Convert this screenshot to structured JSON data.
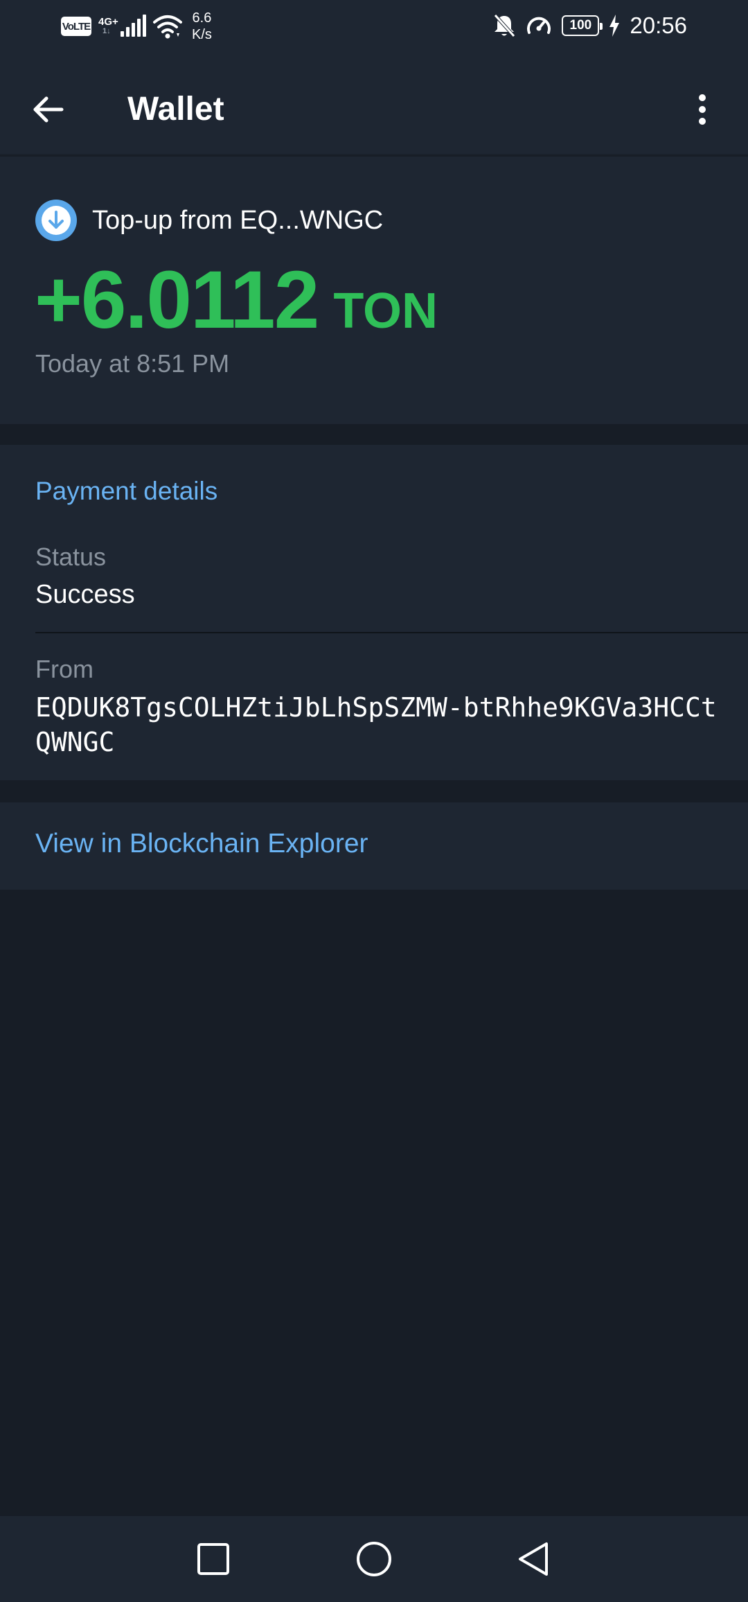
{
  "status_bar": {
    "volte": "VoLTE",
    "network": "4G+",
    "network_sub": "1↓",
    "speed_value": "6.6",
    "speed_unit": "K/s",
    "battery": "100",
    "time": "20:56"
  },
  "app_bar": {
    "title": "Wallet"
  },
  "transaction": {
    "title": "Top-up from EQ...WNGC",
    "amount": "+6.0112",
    "currency": "TON",
    "date": "Today at 8:51 PM",
    "accent_color": "#2fbf58"
  },
  "payment_details": {
    "section_title": "Payment details",
    "status_label": "Status",
    "status_value": "Success",
    "from_label": "From",
    "from_value": "EQDUK8TgsCOLHZtiJbLhSpSZMW-btRhhe9KGVa3HCCtQWNGC"
  },
  "explorer": {
    "link_label": "View in Blockchain Explorer",
    "link_color": "#6ab3f3"
  },
  "nav_bar": {
    "recents": "square-icon",
    "home": "circle-icon",
    "back": "triangle-icon"
  }
}
